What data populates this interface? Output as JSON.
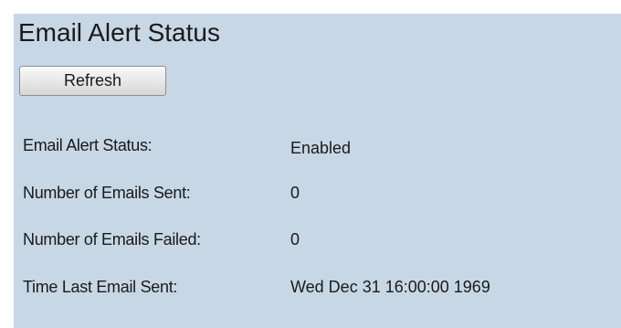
{
  "page": {
    "title": "Email Alert Status"
  },
  "toolbar": {
    "refresh_label": "Refresh"
  },
  "status_rows": [
    {
      "label": "Email Alert Status:",
      "value": "Enabled"
    },
    {
      "label": "Number of Emails Sent:",
      "value": "0"
    },
    {
      "label": "Number of Emails Failed:",
      "value": "0"
    },
    {
      "label": "Time Last Email Sent:",
      "value": "Wed Dec 31 16:00:00 1969"
    }
  ],
  "colors": {
    "panel_background": "#c8d7e6",
    "page_background": "#ffffff",
    "text": "#1a1a1a"
  }
}
